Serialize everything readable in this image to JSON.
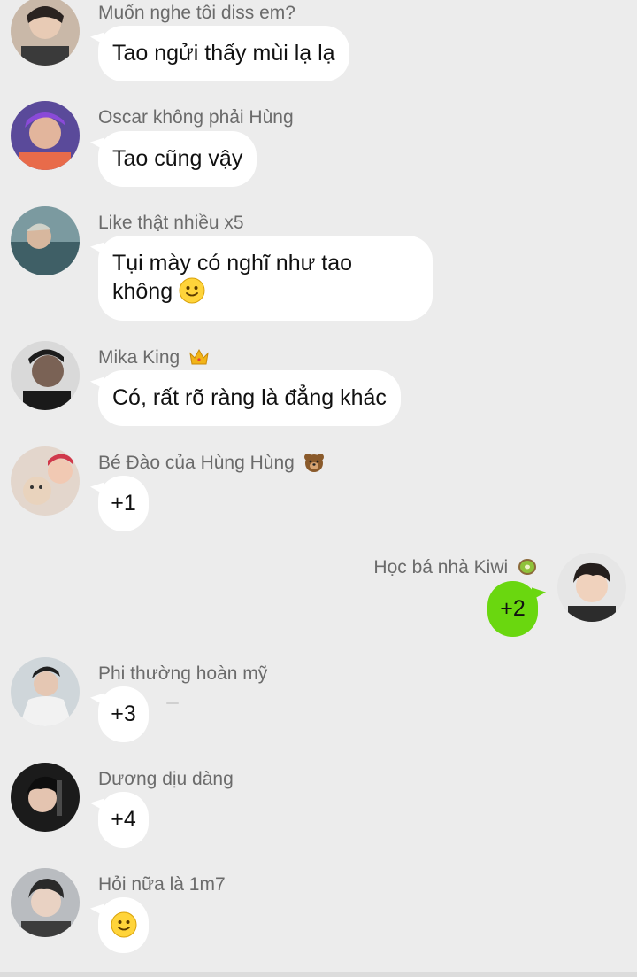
{
  "messages": [
    {
      "sender": "Muốn nghe tôi diss em?",
      "text": "Tao ngửi thấy mùi lạ lạ",
      "avatar": "avatar-1"
    },
    {
      "sender": "Oscar không phải Hùng",
      "text": "Tao cũng vậy",
      "avatar": "avatar-2"
    },
    {
      "sender": "Like thật nhiều x5",
      "text_line1": "Tụi mày có nghĩ như tao",
      "text_line2": "không",
      "text_emoji": "slightly-smiling-face-icon",
      "avatar": "avatar-3"
    },
    {
      "sender": "Mika King",
      "sender_emoji": "crown-icon",
      "text": "Có, rất rõ ràng là đẳng khác",
      "avatar": "avatar-4"
    },
    {
      "sender": "Bé Đào của Hùng Hùng",
      "sender_emoji": "bear-face-icon",
      "text": "+1",
      "avatar": "avatar-5"
    },
    {
      "sender": "Học bá nhà Kiwi",
      "sender_emoji": "kiwi-icon",
      "text": "+2",
      "avatar": "avatar-self",
      "outgoing": true
    },
    {
      "sender": "Phi thường hoàn mỹ",
      "text": "+3",
      "avatar": "avatar-7"
    },
    {
      "sender": "Dương dịu dàng",
      "text": "+4",
      "avatar": "avatar-8"
    },
    {
      "sender": "Hỏi nữa là 1m7",
      "text_emoji": "slightly-smiling-face-icon",
      "avatar": "avatar-9"
    }
  ],
  "colors": {
    "background": "#ececec",
    "incoming_bubble": "#ffffff",
    "outgoing_bubble": "#6ad70f",
    "sender_name": "#6b6b6b"
  }
}
